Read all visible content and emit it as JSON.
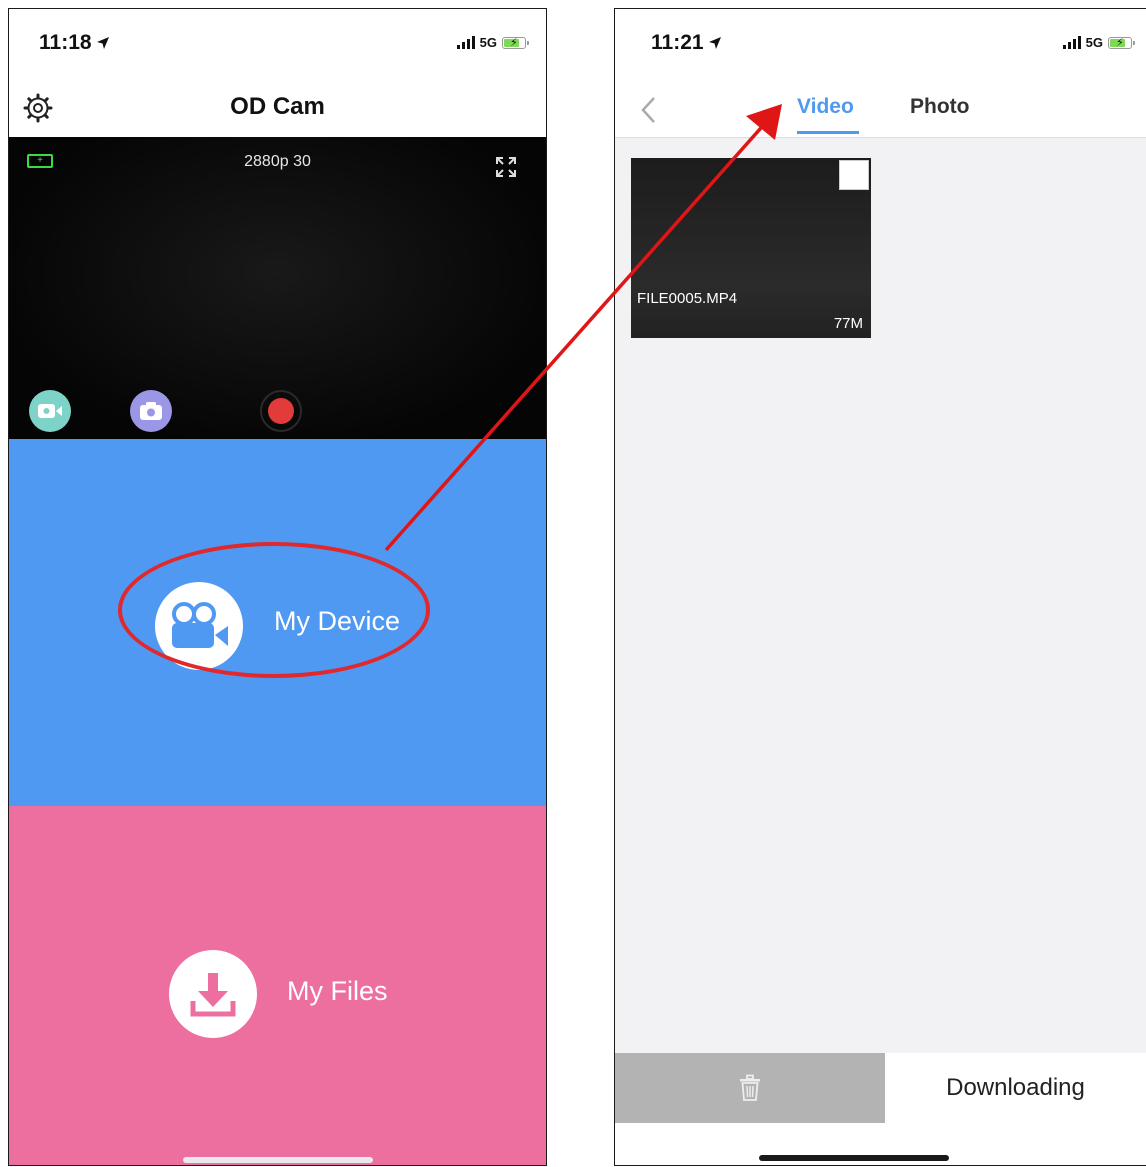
{
  "left_screen": {
    "status": {
      "time": "11:18",
      "network": "5G"
    },
    "header": {
      "title": "OD Cam"
    },
    "preview": {
      "resolution": "2880p 30"
    },
    "tiles": {
      "device_label": "My Device",
      "files_label": "My Files"
    }
  },
  "right_screen": {
    "status": {
      "time": "11:21",
      "network": "5G"
    },
    "tabs": [
      {
        "label": "Video",
        "active": true
      },
      {
        "label": "Photo",
        "active": false
      }
    ],
    "files": [
      {
        "name": "FILE0005.MP4",
        "size": "77M"
      }
    ],
    "bottom": {
      "downloading_label": "Downloading"
    }
  },
  "colors": {
    "device_tile": "#4f99f2",
    "files_tile": "#ec6fa0",
    "accent": "#4f99f2",
    "annotation_red": "#e0282d"
  },
  "icons": [
    "location-arrow-icon",
    "signal-icon",
    "battery-icon",
    "gear-icon",
    "camera-battery-icon",
    "fullscreen-icon",
    "video-mode-icon",
    "photo-mode-icon",
    "record-icon",
    "movie-camera-icon",
    "download-icon",
    "back-chevron-icon",
    "trash-icon"
  ]
}
